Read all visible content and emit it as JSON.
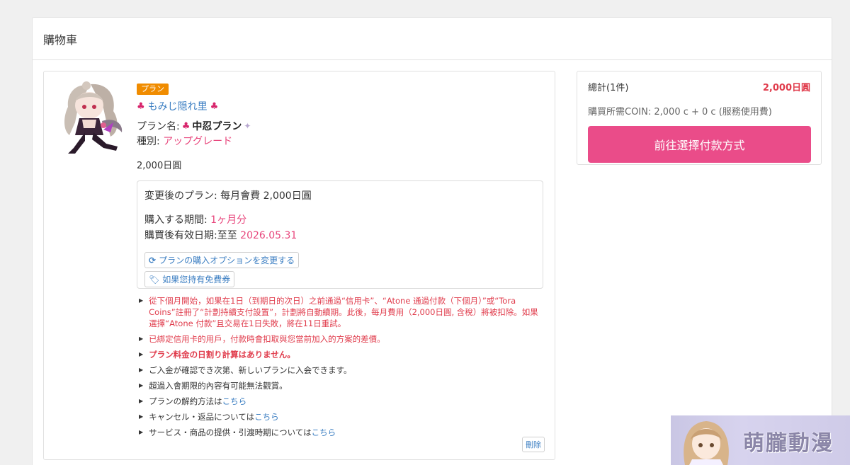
{
  "header": {
    "title": "購物車"
  },
  "item": {
    "badge": "プラン",
    "creator": "もみじ隠れ里",
    "plan_label": "プラン名:",
    "plan_name": "中忍プラン",
    "type_label": "種別:",
    "type_value": "アップグレード",
    "price": "2,000日圓",
    "option": {
      "after_plan": "変更後のプラン: 每月會費 2,000日圓",
      "period_label": "購入する期間:",
      "period_value": "1ヶ月分",
      "valid_label": "購買後有效日期:至至",
      "valid_value": "2026.05.31",
      "change_option_button": "プランの購入オプションを変更する",
      "coupon_button": "如果您持有免費券"
    },
    "notes": {
      "n1": "從下個月開始，如果在1日（到期日的次日）之前通過“信用卡”、“Atone 通過付款（下個月）”或“Tora Coins”註冊了“計劃持續支付設置”，計劃將自動續期。此後，每月費用（2,000日圓, 含稅）將被扣除。如果選擇“Atone 付款”且交易在1日失敗，將在11日重試。",
      "n2": "已綁定信用卡的用戶，付款時會扣取與您當前加入的方案的差價。",
      "n3": "プラン料金の日割り計算はありません。",
      "n4": "ご入金が確認でき次第、新しいプランに入会できます。",
      "n5": "超過入會期限的內容有可能無法觀賞。",
      "n6_text": "プランの解約方法は",
      "n6_link": "こちら",
      "n7_text": "キャンセル・返品については",
      "n7_link": "こちら",
      "n8_text": "サービス・商品の提供・引渡時期については",
      "n8_link": "こちら"
    },
    "delete_button": "刪除"
  },
  "summary": {
    "total_label": "總計(1件)",
    "total_value": "2,000日圓",
    "coin_text": "購買所需COIN: 2,000 c + 0 c (服務使用費)",
    "checkout_button": "前往選擇付款方式"
  },
  "watermark": {
    "text": "萌朧動漫"
  },
  "colors": {
    "accent_pink": "#ea4c89",
    "badge_orange": "#f08c00",
    "link_blue": "#3b7ec2",
    "alert_red": "#e03c4c"
  }
}
